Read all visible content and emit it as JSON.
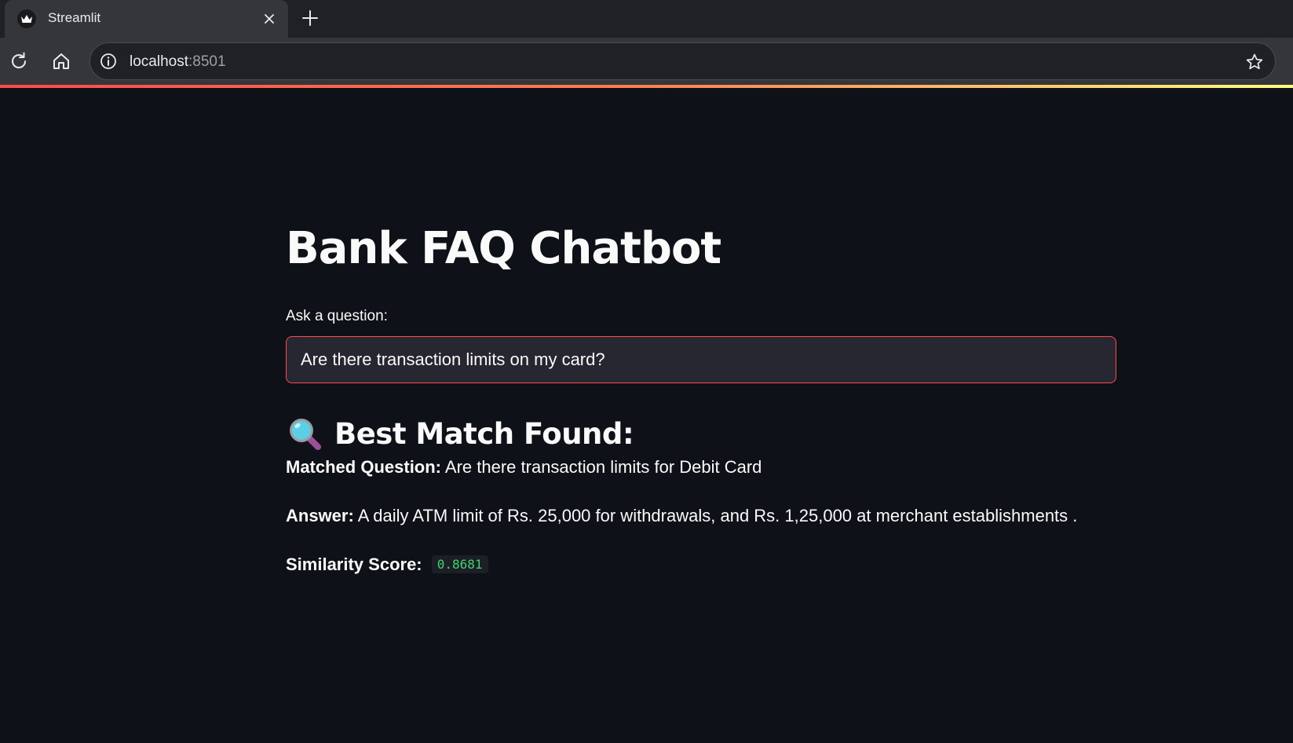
{
  "browser": {
    "tab_title": "Streamlit",
    "url_host": "localhost",
    "url_port": ":8501"
  },
  "app": {
    "title": "Bank FAQ Chatbot",
    "input_label": "Ask a question:",
    "input_value": "Are there transaction limits on my card?",
    "result_heading": "Best Match Found:",
    "matched_question_label": "Matched Question:",
    "matched_question_value": "Are there transaction limits for Debit Card",
    "answer_label": "Answer:",
    "answer_value": "A daily ATM limit of Rs. 25,000 for withdrawals, and Rs. 1,25,000 at merchant establishments .",
    "score_label": "Similarity Score:",
    "score_value": "0.8681"
  },
  "colors": {
    "background": "#0e1117",
    "accent": "#ff4b4b",
    "input_background": "#262730",
    "code_text": "#3dd56d"
  },
  "icons": [
    "streamlit-crown-icon",
    "close-icon",
    "plus-icon",
    "reload-icon",
    "home-icon",
    "info-icon",
    "star-icon",
    "magnifying-glass-icon"
  ]
}
